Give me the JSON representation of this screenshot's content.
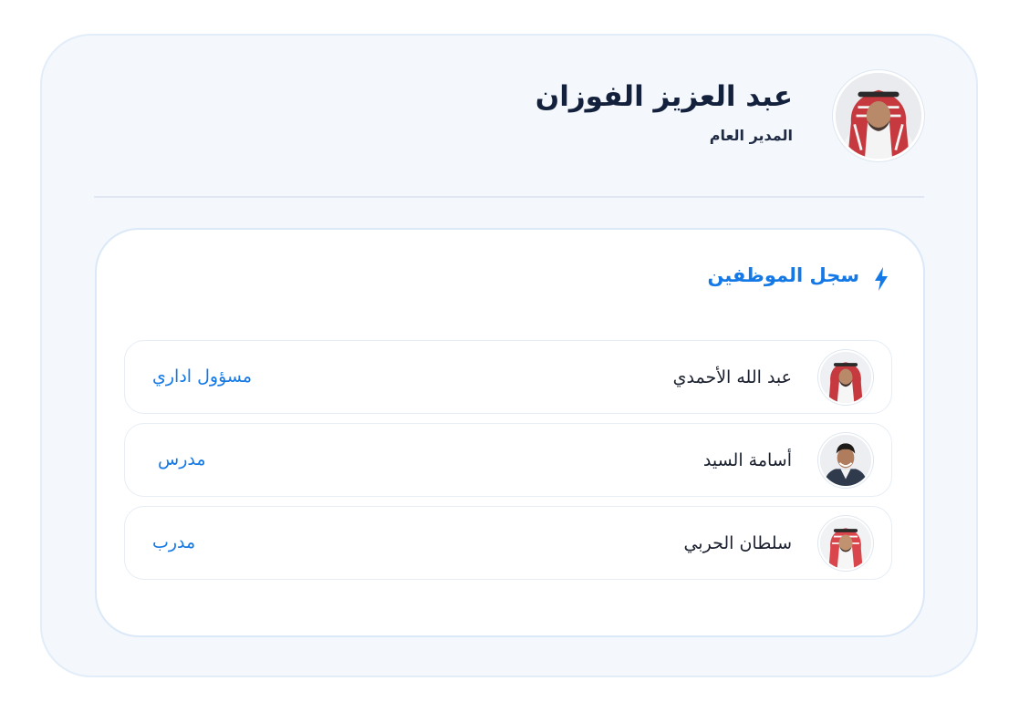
{
  "manager": {
    "name": "عبد العزيز الفوزان",
    "role": "المدير العام",
    "avatar_icon": "person-avatar-icon"
  },
  "employees_panel": {
    "title": "سجل الموظفين",
    "title_icon": "lightning-bolt-icon",
    "accent_color": "#1479e6",
    "employees": [
      {
        "name": "عبد الله الأحمدي",
        "role": "مسؤول اداري"
      },
      {
        "name": "أسامة السيد",
        "role": "مدرس"
      },
      {
        "name": "سلطان الحربي",
        "role": "مدرب"
      }
    ]
  }
}
